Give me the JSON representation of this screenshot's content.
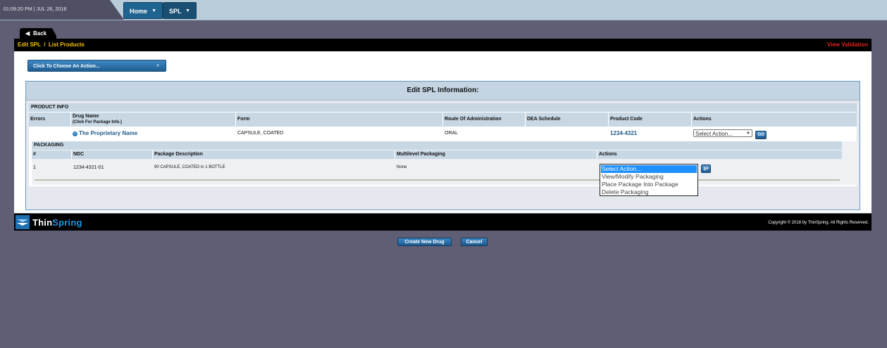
{
  "header": {
    "clock": "01:09:20 PM | JUL 26, 2018",
    "tabs": [
      {
        "label": "Home"
      },
      {
        "label": "SPL"
      }
    ]
  },
  "back_label": "Back",
  "breadcrumb": "Edit SPL  /  List Products",
  "view_validation": "View Validation",
  "action_dropdown": "Click To Choose An Action...",
  "edit_title": "Edit SPL Information:",
  "product": {
    "section_label": "PRODUCT INFO",
    "columns": {
      "errors": "Errors",
      "drug_name": "Drug Name",
      "drug_name_sub": "(Click For Package Info.)",
      "form": "Form",
      "route": "Route Of Administration",
      "dea": "DEA Schedule",
      "code": "Product Code",
      "actions": "Actions"
    },
    "row": {
      "drug_name": "The Proprietary Name",
      "form": "CAPSULE, COATED",
      "route": "ORAL",
      "dea": "",
      "code": "1234-4321",
      "action_select": "Select Action...",
      "go": "GO"
    }
  },
  "packaging": {
    "section_label": "PACKAGING",
    "columns": {
      "num": "#",
      "ndc": "NDC",
      "desc": "Package Description",
      "multi": "Multilevel Packaging",
      "actions": "Actions"
    },
    "row": {
      "num": "1",
      "ndc": "1234-4321-01",
      "desc": "90  CAPSULE, COATED in 1  BOTTLE",
      "multi": "None",
      "go": "go"
    },
    "dropdown_options": [
      "Select Action...",
      "View/Modify Packaging",
      "Place Package Into Package",
      "Delete Packaging"
    ],
    "selected_index": 0
  },
  "buttons": {
    "create": "Create New Drug",
    "cancel": "Cancel"
  },
  "footer": {
    "logo_thin": "Thin",
    "logo_spring": "Spring",
    "copyright": "Copyright © 2018 by ThinSpring. All Rights Reserved."
  },
  "colors": {
    "breadcrumb": "#f0c000",
    "view_validation": "#e2231a",
    "nav_blue": "#1f6490",
    "logo_accent": "#1e95e0"
  }
}
